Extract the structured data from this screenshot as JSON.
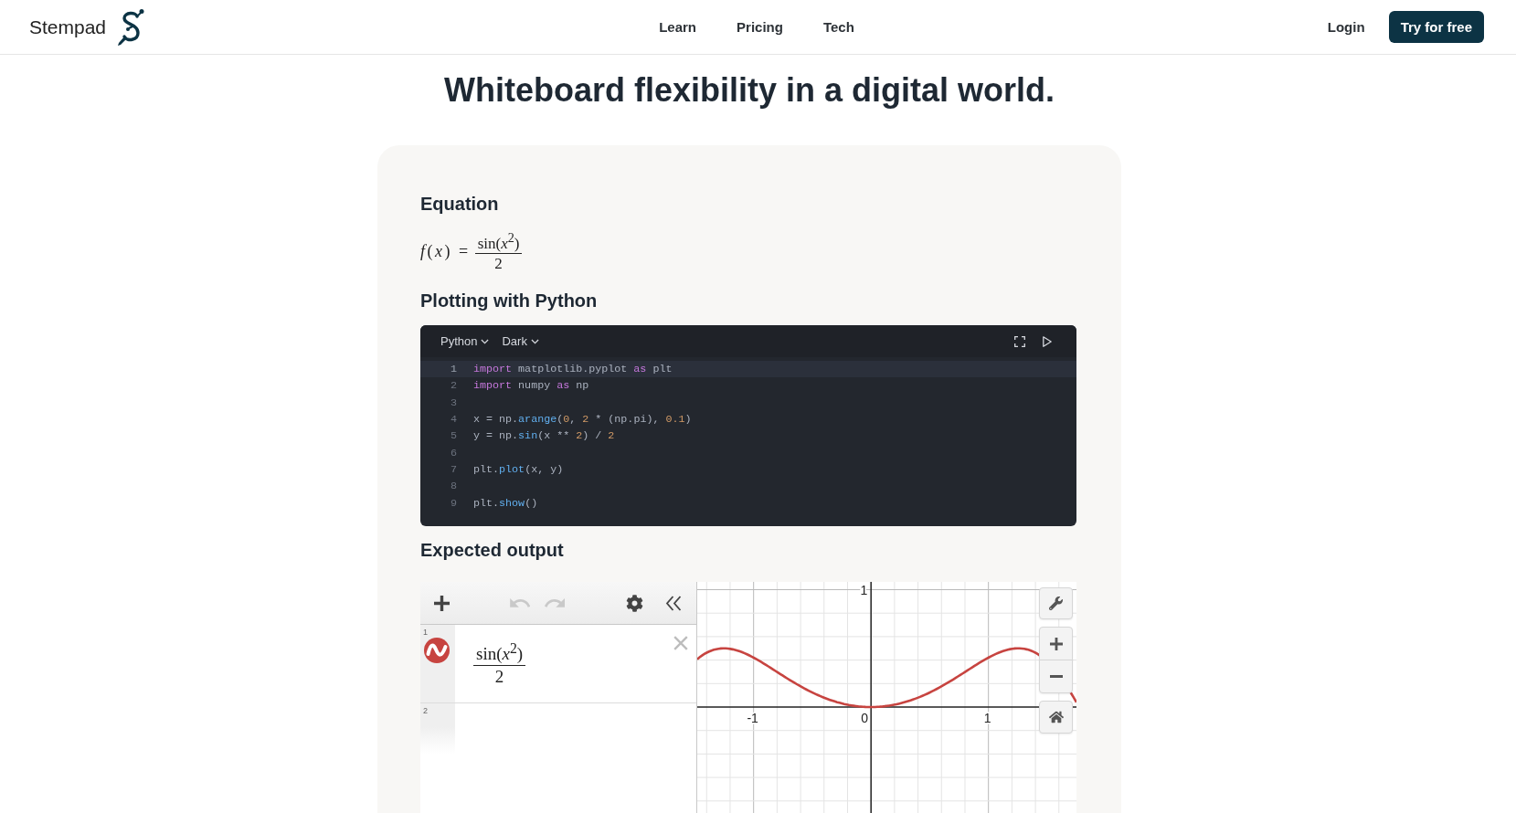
{
  "header": {
    "brand": "Stempad",
    "nav": [
      "Learn",
      "Pricing",
      "Tech"
    ],
    "login": "Login",
    "cta": "Try for free"
  },
  "title": "Whiteboard flexibility in a digital world.",
  "equation_section": {
    "heading": "Equation",
    "equation": {
      "lhs": "*f*(*x*) =",
      "numerator": "sin(*x*$^{2}$)",
      "denominator": "2"
    }
  },
  "code_section": {
    "heading": "Plotting with Python",
    "editor": {
      "language": "Python",
      "theme": "Dark",
      "lines": [
        {
          "number": "1",
          "active": true,
          "tokens": [
            {
              "text": "import",
              "kind": "keyword"
            },
            {
              "text": " matplotlib.pyplot ",
              "kind": "plain"
            },
            {
              "text": "as",
              "kind": "keyword"
            },
            {
              "text": " plt",
              "kind": "plain"
            }
          ]
        },
        {
          "number": "2",
          "active": false,
          "tokens": [
            {
              "text": "import",
              "kind": "keyword"
            },
            {
              "text": " numpy ",
              "kind": "plain"
            },
            {
              "text": "as",
              "kind": "keyword"
            },
            {
              "text": " np",
              "kind": "plain"
            }
          ]
        },
        {
          "number": "3",
          "active": false
        },
        {
          "number": "4",
          "active": false,
          "tokens": [
            {
              "text": "x = np.",
              "kind": "plain"
            },
            {
              "text": "arange",
              "kind": "function"
            },
            {
              "text": "(",
              "kind": "plain"
            },
            {
              "text": "0",
              "kind": "number"
            },
            {
              "text": ", ",
              "kind": "plain"
            },
            {
              "text": "2",
              "kind": "number"
            },
            {
              "text": " * (np.pi), ",
              "kind": "plain"
            },
            {
              "text": "0.1",
              "kind": "number"
            },
            {
              "text": ")",
              "kind": "plain"
            }
          ]
        },
        {
          "number": "5",
          "active": false,
          "tokens": [
            {
              "text": "y = np.",
              "kind": "plain"
            },
            {
              "text": "sin",
              "kind": "function"
            },
            {
              "text": "(x ** ",
              "kind": "plain"
            },
            {
              "text": "2",
              "kind": "number"
            },
            {
              "text": ") / ",
              "kind": "plain"
            },
            {
              "text": "2",
              "kind": "number"
            }
          ]
        },
        {
          "number": "6",
          "active": false
        },
        {
          "number": "7",
          "active": false,
          "tokens": [
            {
              "text": "plt.",
              "kind": "plain"
            },
            {
              "text": "plot",
              "kind": "function"
            },
            {
              "text": "(x, y)",
              "kind": "plain"
            }
          ]
        },
        {
          "number": "8",
          "active": false
        },
        {
          "number": "9",
          "active": false,
          "tokens": [
            {
              "text": "plt.",
              "kind": "plain"
            },
            {
              "text": "show",
              "kind": "function"
            },
            {
              "text": "()",
              "kind": "plain"
            }
          ]
        }
      ]
    }
  },
  "output_section": {
    "heading": "Expected output",
    "calculator": {
      "undo": {
        "disabled": true
      },
      "redo": {
        "disabled": true
      },
      "expressions": [
        {
          "kind": "expression",
          "index": "1",
          "color": "#c74440",
          "numerator": "sin(*x*$^{2}$)",
          "denominator": "2"
        },
        {
          "kind": "blank",
          "index": "2"
        }
      ],
      "graph": {
        "grid": true,
        "x_labels": [
          "-1",
          "0",
          "1"
        ],
        "y_labels": [
          "1"
        ]
      }
    }
  }
}
